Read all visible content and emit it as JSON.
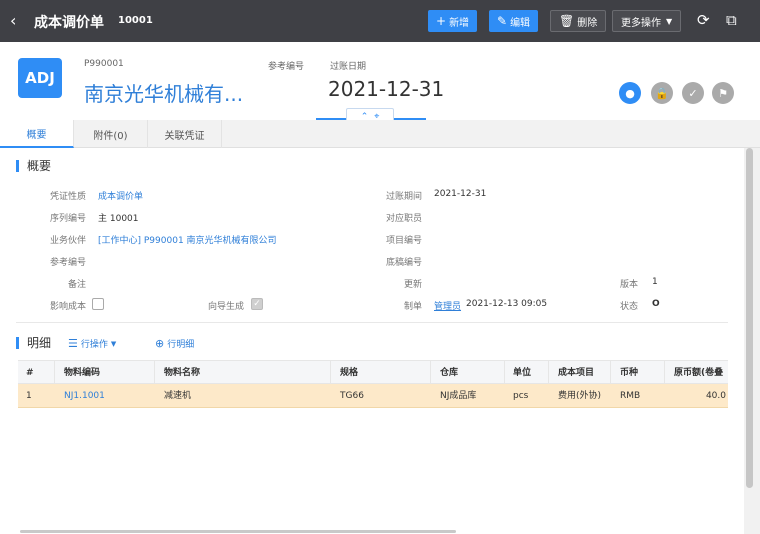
{
  "topbar": {
    "title": "成本调价单",
    "doc_no": "10001",
    "buttons": {
      "new": "新增",
      "edit": "编辑",
      "delete": "删除",
      "more": "更多操作"
    }
  },
  "header": {
    "avatar": "ADJ",
    "code": "P990001",
    "partner": "南京光华机械有...",
    "ref_label": "参考编号",
    "post_date_label": "过账日期",
    "post_date": "2021-12-31"
  },
  "tabs": [
    "概要",
    "附件(0)",
    "关联凭证"
  ],
  "summary": {
    "title": "概要",
    "fields": {
      "nature_label": "凭证性质",
      "nature": "成本调价单",
      "serial_label": "序列编号",
      "serial": "主 10001",
      "partner_label": "业务伙伴",
      "partner": "[工作中心] P990001 南京光华机械有限公司",
      "ref_label": "参考编号",
      "remark_label": "备注",
      "affect_cost_label": "影响成本",
      "wizard_label": "向导生成",
      "period_label": "过账期间",
      "period": "2021-12-31",
      "staff_label": "对应职员",
      "project_label": "项目编号",
      "draft_label": "底稿编号",
      "update_label": "更新",
      "maker_label": "制单",
      "maker": "管理员",
      "maker_time": "2021-12-13 09:05",
      "version_label": "版本",
      "version": "1",
      "status_label": "状态",
      "status": "O"
    }
  },
  "detail": {
    "title": "明细",
    "row_ops": "行操作",
    "row_detail": "行明细",
    "columns": [
      "#",
      "物料编码",
      "物料名称",
      "规格",
      "仓库",
      "单位",
      "成本项目",
      "币种",
      "原币额(卷叠"
    ],
    "rows": [
      [
        "1",
        "NJ1.1001",
        "减速机",
        "TG66",
        "NJ成品库",
        "pcs",
        "费用(外协)",
        "RMB",
        "40.0"
      ]
    ]
  }
}
